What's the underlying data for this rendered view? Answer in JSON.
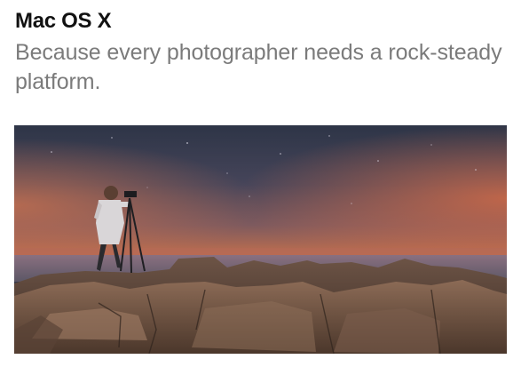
{
  "header": {
    "title": "Mac OS X",
    "tagline": "Because every photographer needs a rock-steady platform."
  },
  "hero_image": {
    "subject": "photographer-at-dusk-photo",
    "colors": {
      "sky_top": "#2f3646",
      "sky_mid": "#4a4656",
      "horizon_glow": "#d2744a",
      "water": "#6e6a78",
      "rocks_light": "#8a6a55",
      "rocks_dark": "#3a2c25"
    }
  }
}
